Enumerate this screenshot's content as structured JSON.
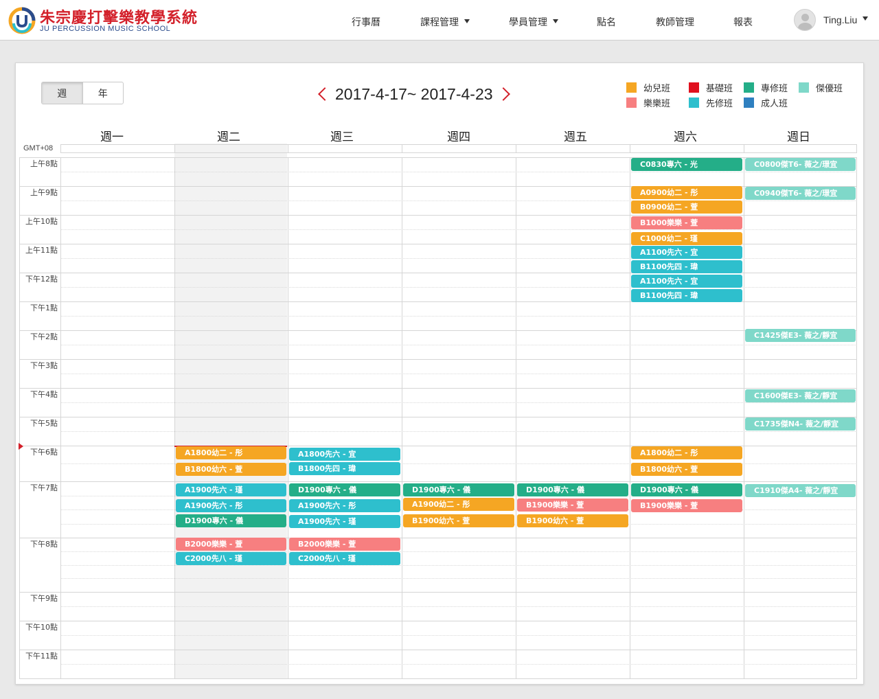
{
  "brand": {
    "name_zh": "朱宗慶打擊樂教學系統",
    "name_en": "JU PERCUSSION MUSIC SCHOOL",
    "color_red": "#d3202a",
    "color_blue": "#2b4c8c"
  },
  "nav": {
    "items": [
      {
        "label": "行事曆",
        "dropdown": false
      },
      {
        "label": "課程管理",
        "dropdown": true
      },
      {
        "label": "學員管理",
        "dropdown": true
      },
      {
        "label": "點名",
        "dropdown": false
      },
      {
        "label": "教師管理",
        "dropdown": false
      },
      {
        "label": "報表",
        "dropdown": false
      }
    ]
  },
  "user": {
    "name": "Ting.Liu",
    "icon": "avatar-icon"
  },
  "view_toggle": {
    "week": "週",
    "year": "年",
    "selected": "week"
  },
  "date_range": "2017-4-17~ 2017-4-23",
  "legend": [
    {
      "label": "幼兒班",
      "color": "#f5a623"
    },
    {
      "label": "基礎班",
      "color": "#e0101e"
    },
    {
      "label": "專修班",
      "color": "#24ae88"
    },
    {
      "label": "傑優班",
      "color": "#7fd8c9"
    },
    {
      "label": "樂樂班",
      "color": "#f77f80"
    },
    {
      "label": "先修班",
      "color": "#2ebfcd"
    },
    {
      "label": "成人班",
      "color": "#2f80c0"
    }
  ],
  "calendar": {
    "timezone": "GMT+08",
    "days": [
      "週一",
      "週二",
      "週三",
      "週四",
      "週五",
      "週六",
      "週日"
    ],
    "hours": [
      "上午8點",
      "上午9點",
      "上午10點",
      "上午11點",
      "下午12點",
      "下午1點",
      "下午2點",
      "下午3點",
      "下午4點",
      "下午5點",
      "下午6點",
      "下午7點",
      "下午8點",
      "下午9點",
      "下午10點",
      "下午11點"
    ],
    "events": [
      {
        "day": 5,
        "label": "C0830專六 - 光",
        "class": "專修班"
      },
      {
        "day": 5,
        "label": "A0900幼二 - 彤",
        "class": "幼兒班"
      },
      {
        "day": 5,
        "label": "B0900幼二 - 萱",
        "class": "幼兒班"
      },
      {
        "day": 5,
        "label": "B1000樂樂 - 萱",
        "class": "樂樂班"
      },
      {
        "day": 5,
        "label": "C1000幼二 - 瑾",
        "class": "幼兒班"
      },
      {
        "day": 5,
        "label": "A1100先六 - 宜",
        "class": "先修班"
      },
      {
        "day": 5,
        "label": "B1100先四 - 瑋",
        "class": "先修班"
      },
      {
        "day": 5,
        "label": "A1100先六 - 宜",
        "class": "先修班"
      },
      {
        "day": 5,
        "label": "B1100先四 - 瑋",
        "class": "先修班"
      },
      {
        "day": 6,
        "label": "C0800傑T6- 薇之/璟宜",
        "class": "傑優班"
      },
      {
        "day": 6,
        "label": "C0940傑T6- 薇之/璟宜",
        "class": "傑優班"
      },
      {
        "day": 6,
        "label": "C1425傑E3- 薇之/靜宜",
        "class": "傑優班"
      },
      {
        "day": 6,
        "label": "C1600傑E3- 薇之/靜宜",
        "class": "傑優班"
      },
      {
        "day": 6,
        "label": "C1735傑N4- 薇之/靜宜",
        "class": "傑優班"
      },
      {
        "day": 1,
        "label": "A1800幼二 - 彤",
        "class": "幼兒班"
      },
      {
        "day": 1,
        "label": "B1800幼六 - 萱",
        "class": "幼兒班"
      },
      {
        "day": 2,
        "label": "A1800先六 - 宜",
        "class": "先修班"
      },
      {
        "day": 2,
        "label": "B1800先四 - 瑋",
        "class": "先修班"
      },
      {
        "day": 5,
        "label": "A1800幼二 - 彤",
        "class": "幼兒班"
      },
      {
        "day": 5,
        "label": "B1800幼六 - 萱",
        "class": "幼兒班"
      },
      {
        "day": 1,
        "label": "A1900先六 - 瑾",
        "class": "先修班"
      },
      {
        "day": 1,
        "label": "A1900先六 - 彤",
        "class": "先修班"
      },
      {
        "day": 1,
        "label": "D1900專六 - 儀",
        "class": "專修班"
      },
      {
        "day": 2,
        "label": "D1900專六 - 儀",
        "class": "專修班"
      },
      {
        "day": 2,
        "label": "A1900先六 - 彤",
        "class": "先修班"
      },
      {
        "day": 2,
        "label": "A1900先六 - 瑾",
        "class": "先修班"
      },
      {
        "day": 3,
        "label": "D1900專六 - 儀",
        "class": "專修班"
      },
      {
        "day": 3,
        "label": "A1900幼二 - 彤",
        "class": "幼兒班"
      },
      {
        "day": 3,
        "label": "B1900幼六 - 萱",
        "class": "幼兒班"
      },
      {
        "day": 4,
        "label": "D1900專六 - 儀",
        "class": "專修班"
      },
      {
        "day": 4,
        "label": "B1900樂樂 - 萱",
        "class": "樂樂班"
      },
      {
        "day": 4,
        "label": "B1900幼六 - 萱",
        "class": "幼兒班"
      },
      {
        "day": 5,
        "label": "D1900專六 - 儀",
        "class": "專修班"
      },
      {
        "day": 5,
        "label": "B1900樂樂 - 萱",
        "class": "樂樂班"
      },
      {
        "day": 6,
        "label": "C1910傑A4- 薇之/靜宜",
        "class": "傑優班"
      },
      {
        "day": 1,
        "label": "B2000樂樂 - 萱",
        "class": "樂樂班"
      },
      {
        "day": 1,
        "label": "C2000先八 - 瑾",
        "class": "先修班"
      },
      {
        "day": 2,
        "label": "B2000樂樂 - 萱",
        "class": "樂樂班"
      },
      {
        "day": 2,
        "label": "C2000先八 - 瑾",
        "class": "先修班"
      }
    ]
  }
}
